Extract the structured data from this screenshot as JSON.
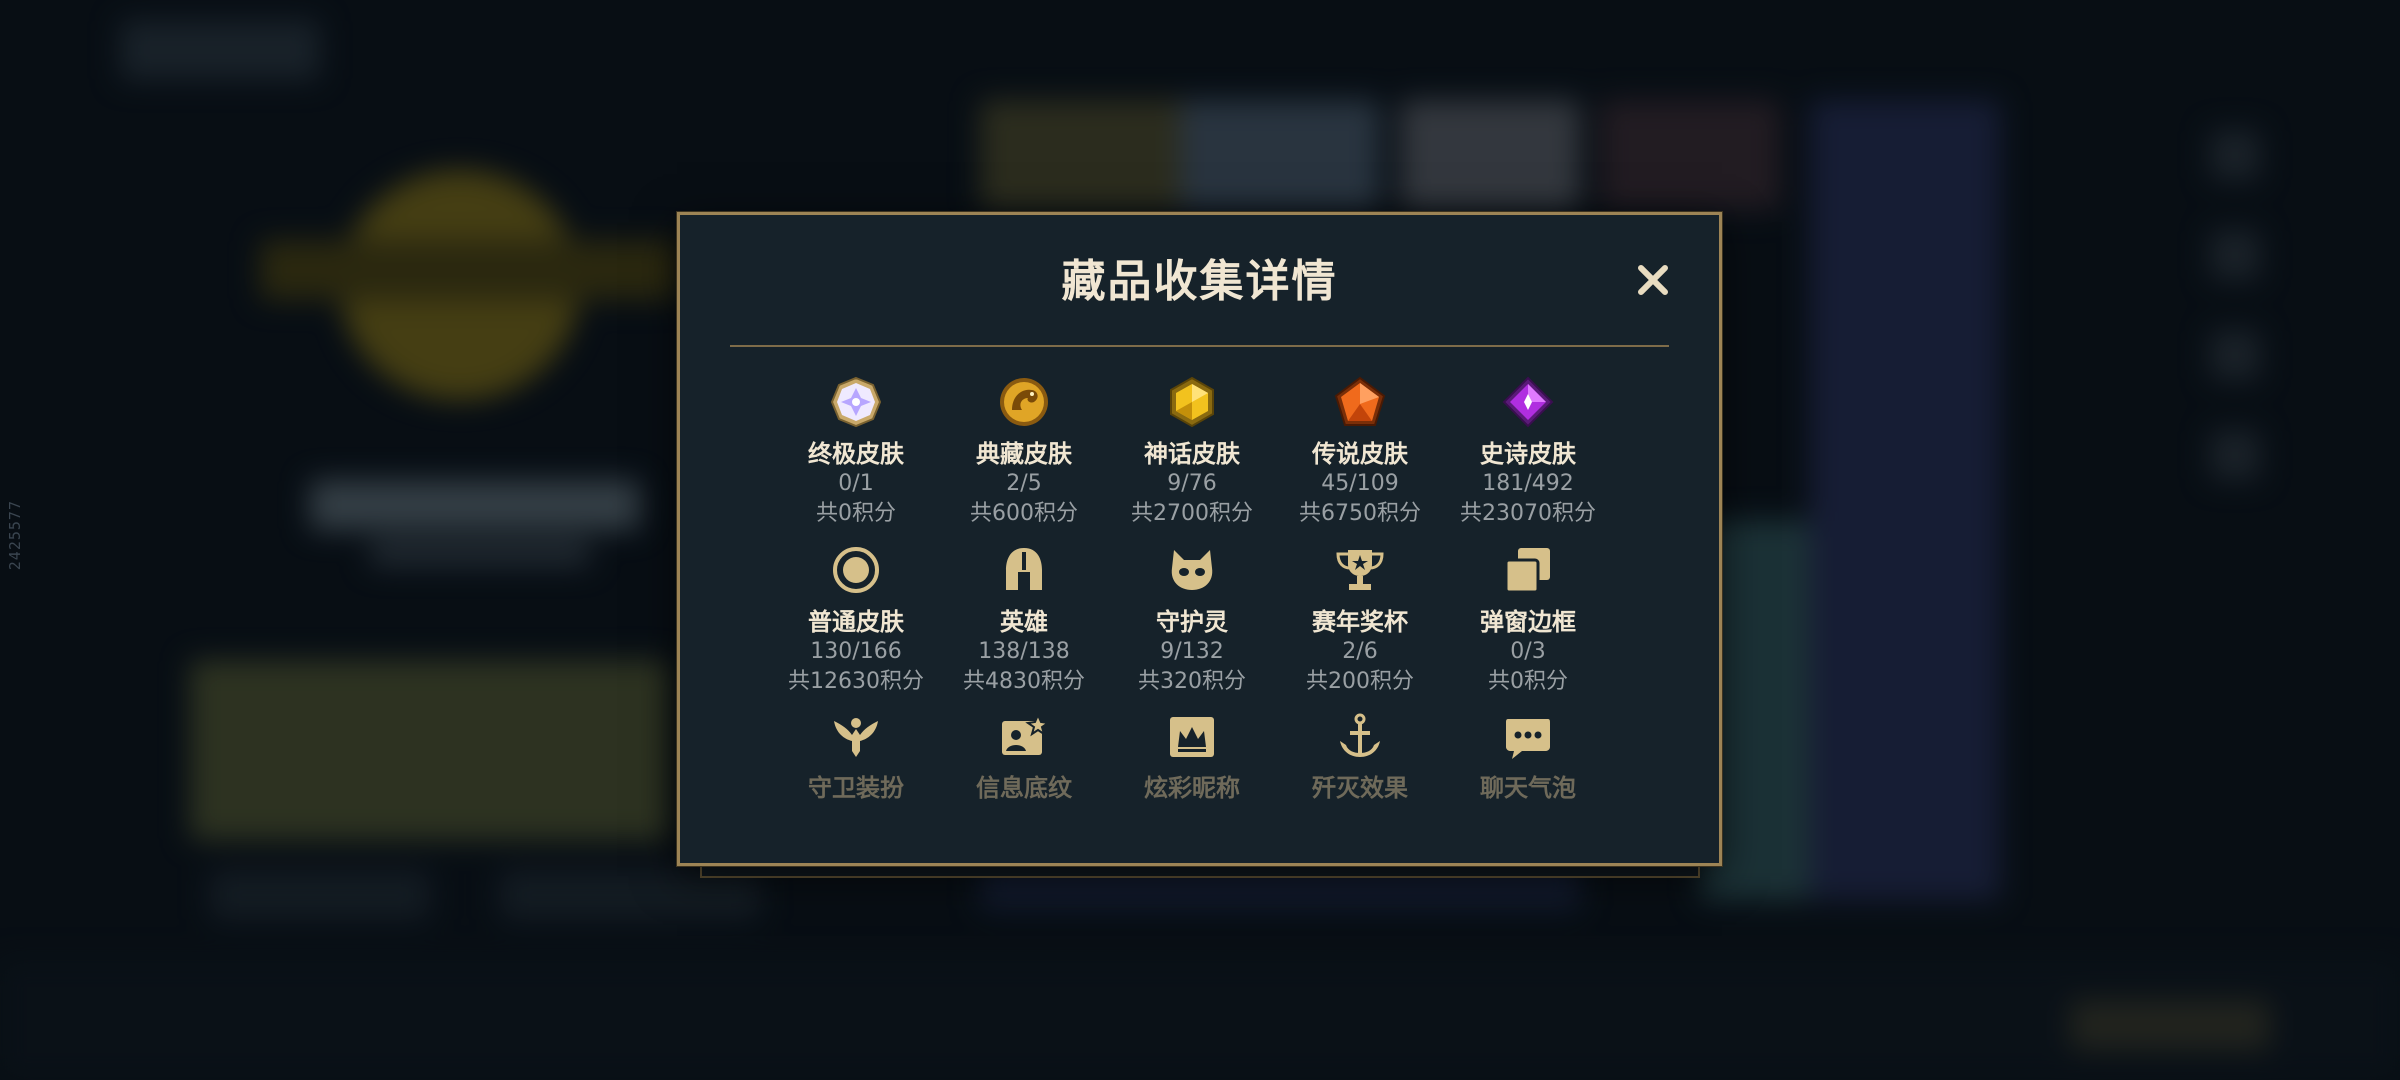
{
  "side_id": "2425577",
  "modal": {
    "title": "藏品收集详情",
    "close_label": "✕"
  },
  "items": [
    {
      "name": "终极皮肤",
      "count": "0/1",
      "points": "共0积分",
      "icon": "ultimate-skin-icon"
    },
    {
      "name": "典藏皮肤",
      "count": "2/5",
      "points": "共600积分",
      "icon": "collector-skin-icon"
    },
    {
      "name": "神话皮肤",
      "count": "9/76",
      "points": "共2700积分",
      "icon": "mythic-skin-icon"
    },
    {
      "name": "传说皮肤",
      "count": "45/109",
      "points": "共6750积分",
      "icon": "legendary-skin-icon"
    },
    {
      "name": "史诗皮肤",
      "count": "181/492",
      "points": "共23070积分",
      "icon": "epic-skin-icon"
    },
    {
      "name": "普通皮肤",
      "count": "130/166",
      "points": "共12630积分",
      "icon": "standard-skin-icon"
    },
    {
      "name": "英雄",
      "count": "138/138",
      "points": "共4830积分",
      "icon": "champion-helmet-icon"
    },
    {
      "name": "守护灵",
      "count": "9/132",
      "points": "共320积分",
      "icon": "companion-icon"
    },
    {
      "name": "赛年奖杯",
      "count": "2/6",
      "points": "共200积分",
      "icon": "season-trophy-icon"
    },
    {
      "name": "弹窗边框",
      "count": "0/3",
      "points": "共0积分",
      "icon": "popup-frame-icon"
    },
    {
      "name": "守卫装扮",
      "icon": "ward-skin-icon"
    },
    {
      "name": "信息底纹",
      "icon": "profile-banner-icon"
    },
    {
      "name": "炫彩昵称",
      "icon": "chroma-nickname-icon"
    },
    {
      "name": "歼灭效果",
      "icon": "elimination-effect-icon"
    },
    {
      "name": "聊天气泡",
      "icon": "chat-bubble-icon"
    }
  ],
  "colors": {
    "gold_border": "#9d8455",
    "title_text": "#f0e6d2",
    "sub_text": "#9aa0a4",
    "icon_gold": "#d6c08a",
    "panel_bg": "#16222a"
  }
}
